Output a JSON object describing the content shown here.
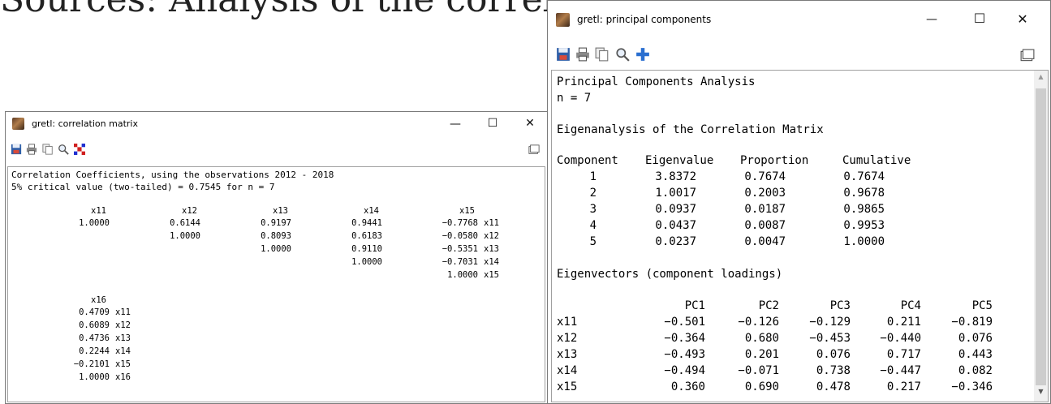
{
  "background_text": "Sources: Analysis of the correlation and principal components of the target",
  "corr_window": {
    "title": "gretl: correlation matrix",
    "controls": {
      "minimize": "—",
      "maximize": "☐",
      "close": "✕"
    },
    "header_lines": [
      "Correlation Coefficients, using the observations 2012 - 2018",
      "5% critical value (two-tailed) = 0.7545 for n = 7"
    ],
    "block1": {
      "columns": [
        "x11",
        "x12",
        "x13",
        "x14",
        "x15"
      ],
      "rows": [
        {
          "cells": [
            "1.0000",
            "0.6144",
            "0.9197",
            "0.9441",
            "−0.7768"
          ],
          "label": "x11"
        },
        {
          "cells": [
            "",
            "1.0000",
            "0.8093",
            "0.6183",
            "−0.0580"
          ],
          "label": "x12"
        },
        {
          "cells": [
            "",
            "",
            "1.0000",
            "0.9110",
            "−0.5351"
          ],
          "label": "x13"
        },
        {
          "cells": [
            "",
            "",
            "",
            "1.0000",
            "−0.7031"
          ],
          "label": "x14"
        },
        {
          "cells": [
            "",
            "",
            "",
            "",
            "1.0000"
          ],
          "label": "x15"
        }
      ]
    },
    "block2": {
      "column": "x16",
      "rows": [
        {
          "value": "0.4709",
          "label": "x11"
        },
        {
          "value": "0.6089",
          "label": "x12"
        },
        {
          "value": "0.4736",
          "label": "x13"
        },
        {
          "value": "0.2244",
          "label": "x14"
        },
        {
          "value": "−0.2101",
          "label": "x15"
        },
        {
          "value": "1.0000",
          "label": "x16"
        }
      ]
    }
  },
  "pca_window": {
    "title": "gretl: principal components",
    "controls": {
      "minimize": "—",
      "maximize": "☐",
      "close": "✕"
    },
    "heading": "Principal Components Analysis",
    "n_line": "n = 7",
    "eigen_title": "Eigenanalysis of the Correlation Matrix",
    "eigen_headers": [
      "Component",
      "Eigenvalue",
      "Proportion",
      "Cumulative"
    ],
    "eigen_rows": [
      [
        "1",
        "3.8372",
        "0.7674",
        "0.7674"
      ],
      [
        "2",
        "1.0017",
        "0.2003",
        "0.9678"
      ],
      [
        "3",
        "0.0937",
        "0.0187",
        "0.9865"
      ],
      [
        "4",
        "0.0437",
        "0.0087",
        "0.9953"
      ],
      [
        "5",
        "0.0237",
        "0.0047",
        "1.0000"
      ]
    ],
    "eigvec_title": "Eigenvectors (component loadings)",
    "pc_headers": [
      "PC1",
      "PC2",
      "PC3",
      "PC4",
      "PC5"
    ],
    "pc_rows": [
      {
        "label": "x11",
        "values": [
          "−0.501",
          "−0.126",
          "−0.129",
          "0.211",
          "−0.819"
        ]
      },
      {
        "label": "x12",
        "values": [
          "−0.364",
          "0.680",
          "−0.453",
          "−0.440",
          "0.076"
        ]
      },
      {
        "label": "x13",
        "values": [
          "−0.493",
          "0.201",
          "0.076",
          "0.717",
          "0.443"
        ]
      },
      {
        "label": "x14",
        "values": [
          "−0.494",
          "−0.071",
          "0.738",
          "−0.447",
          "0.082"
        ]
      },
      {
        "label": "x15",
        "values": [
          "0.360",
          "0.690",
          "0.478",
          "0.217",
          "−0.346"
        ]
      }
    ],
    "scroll_up": "▲",
    "scroll_down": "▼"
  }
}
